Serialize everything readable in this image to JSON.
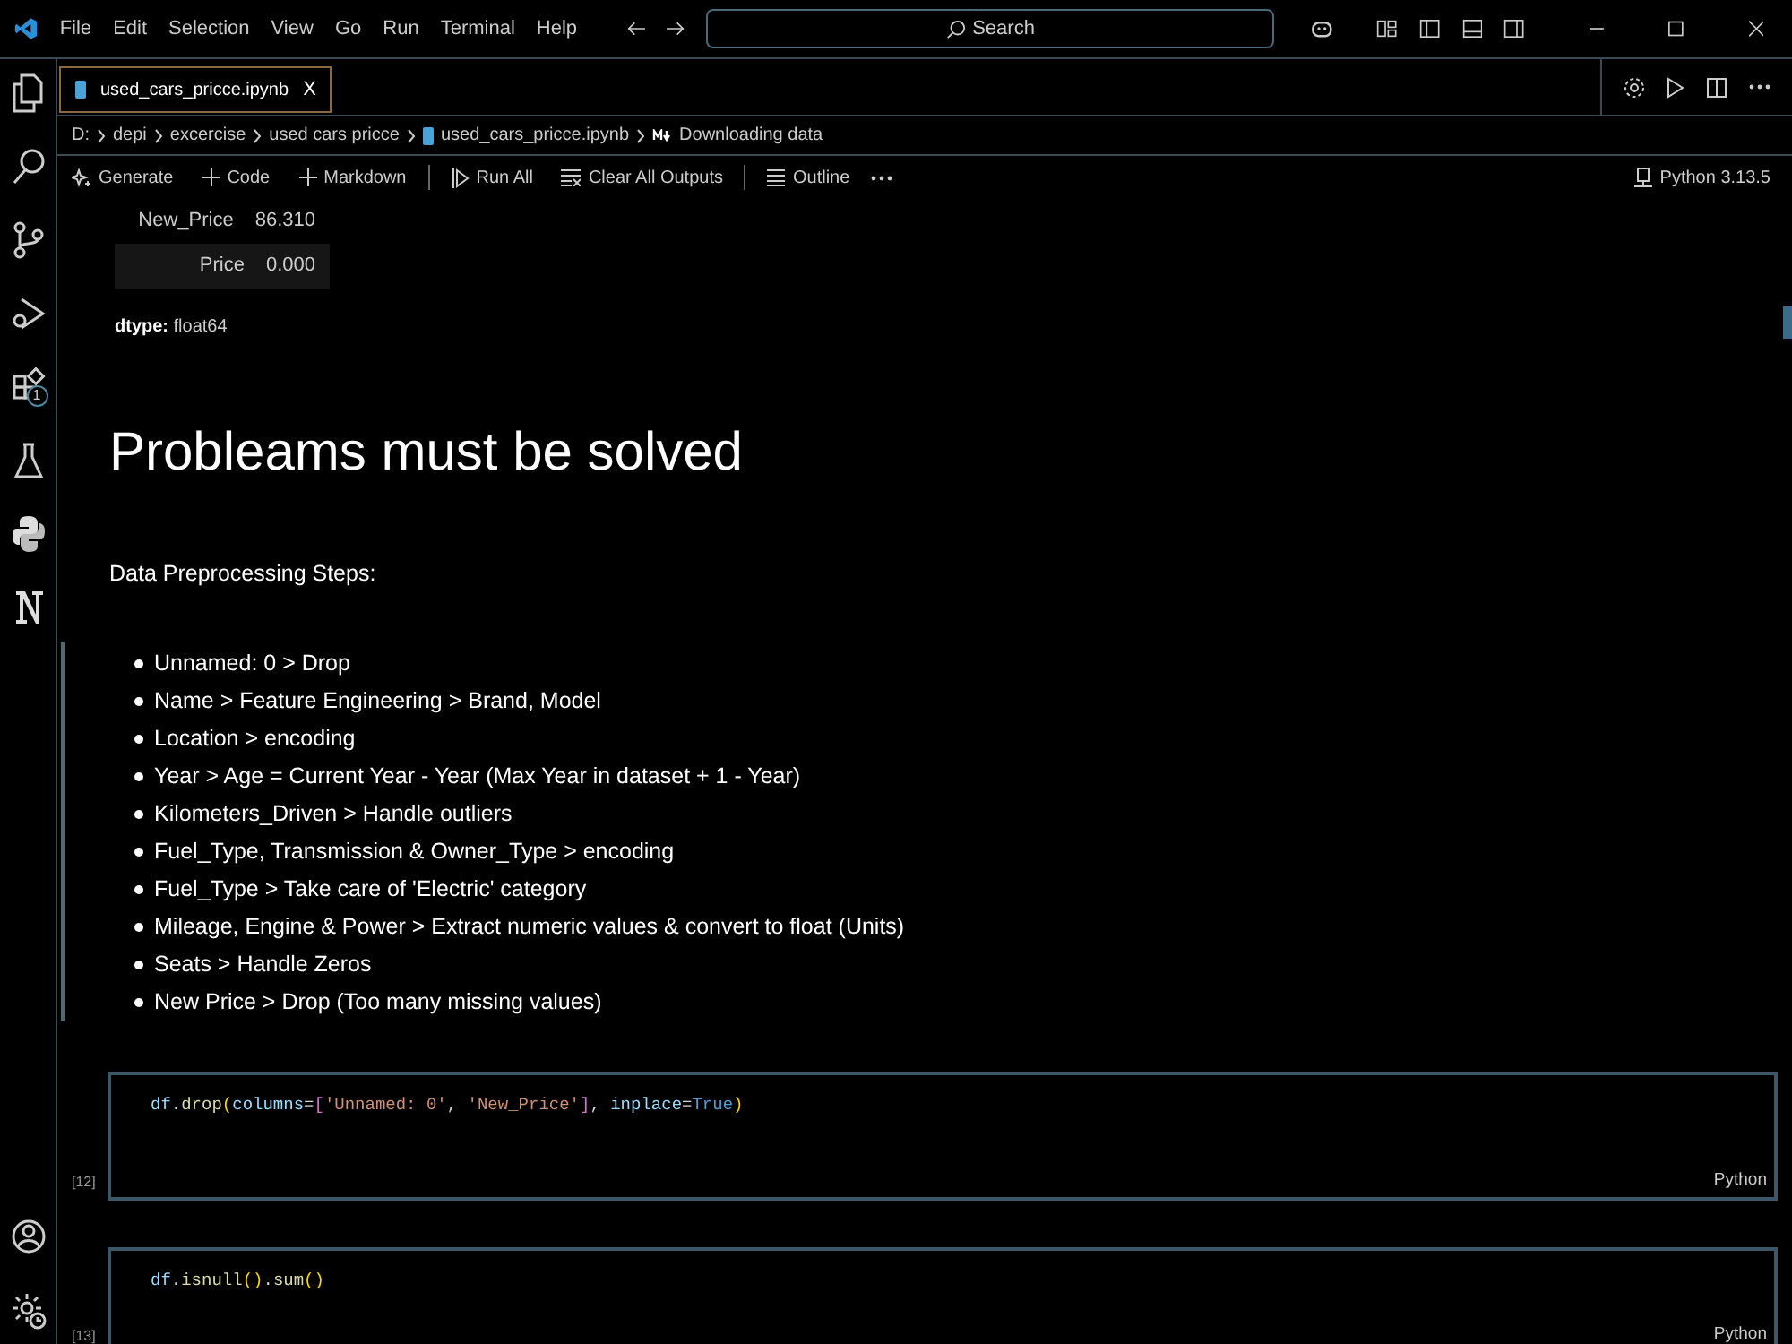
{
  "menu": [
    "File",
    "Edit",
    "Selection",
    "View",
    "Go",
    "Run",
    "Terminal",
    "Help"
  ],
  "search": {
    "placeholder": "Search"
  },
  "tabs": [
    {
      "label": "used_cars_pricce.ipynb",
      "close": "X",
      "selected": true
    }
  ],
  "breadcrumbs": [
    "D:",
    "depi",
    "excercise",
    "used cars pricce",
    "used_cars_pricce.ipynb",
    "Downloading data"
  ],
  "toolbar": [
    "Generate",
    "Code",
    "Markdown",
    "Run All",
    "Clear All Outputs",
    "Outline"
  ],
  "kernel": "Python 3.13.5",
  "activity_badge": "1",
  "output": {
    "rows": [
      {
        "label": "New_Price",
        "value": "86.310"
      },
      {
        "label": "Price",
        "value": "0.000"
      }
    ],
    "dtype_label": "dtype:",
    "dtype": "float64"
  },
  "markdown": {
    "heading": "Probleams must be solved",
    "intro": "Data Preprocessing Steps:",
    "bullets": [
      "Unnamed: 0 > Drop",
      "Name > Feature Engineering > Brand, Model",
      "Location > encoding",
      "Year > Age = Current Year - Year (Max Year in dataset + 1 - Year)",
      "Kilometers_Driven > Handle outliers",
      "Fuel_Type, Transmission & Owner_Type > encoding",
      "Fuel_Type > Take care of 'Electric' category",
      "Mileage, Engine & Power > Extract numeric values & convert to float (Units)",
      "Seats > Handle Zeros",
      "New Price > Drop (Too many missing values)"
    ]
  },
  "cells": [
    {
      "count": "[12]",
      "language": "Python",
      "tokens": [
        {
          "text": "df",
          "kind": "var"
        },
        {
          "text": ".",
          "kind": "plain"
        },
        {
          "text": "drop",
          "kind": "func"
        },
        {
          "text": "(",
          "kind": "paren"
        },
        {
          "text": "columns",
          "kind": "var"
        },
        {
          "text": "=",
          "kind": "plain"
        },
        {
          "text": "[",
          "kind": "bracket"
        },
        {
          "text": "'Unnamed: 0'",
          "kind": "string"
        },
        {
          "text": ", ",
          "kind": "plain"
        },
        {
          "text": "'New_Price'",
          "kind": "string"
        },
        {
          "text": "]",
          "kind": "bracket"
        },
        {
          "text": ", ",
          "kind": "plain"
        },
        {
          "text": "inplace",
          "kind": "var"
        },
        {
          "text": "=",
          "kind": "plain"
        },
        {
          "text": "True",
          "kind": "keyword"
        },
        {
          "text": ")",
          "kind": "paren"
        }
      ]
    },
    {
      "count": "[13]",
      "language": "Python",
      "tokens": [
        {
          "text": "df",
          "kind": "var"
        },
        {
          "text": ".",
          "kind": "plain"
        },
        {
          "text": "isnull",
          "kind": "func"
        },
        {
          "text": "()",
          "kind": "paren"
        },
        {
          "text": ".",
          "kind": "plain"
        },
        {
          "text": "sum",
          "kind": "func"
        },
        {
          "text": "()",
          "kind": "paren"
        }
      ]
    }
  ]
}
